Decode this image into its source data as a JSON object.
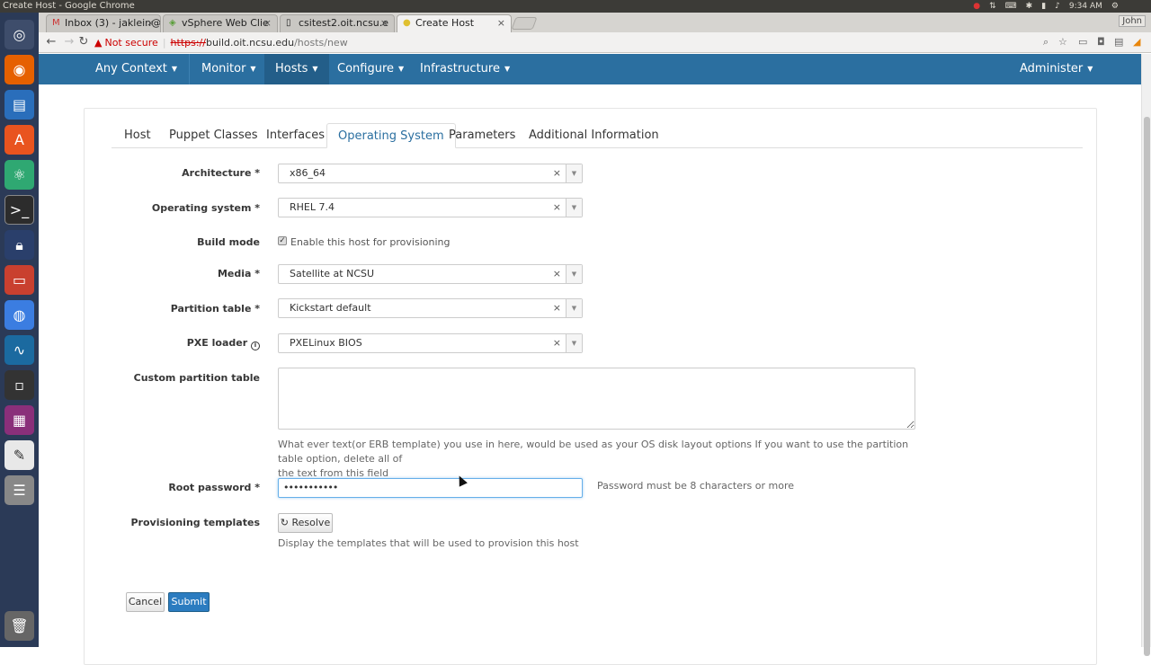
{
  "os": {
    "window_title": "Create Host - Google Chrome",
    "clock": "9:34 AM"
  },
  "launcher": {
    "icons": [
      "ubuntu-logo-icon",
      "firefox-icon",
      "writer-icon",
      "software-center-icon",
      "atom-icon",
      "terminal-icon",
      "lock-icon",
      "files-icon",
      "chrome-icon",
      "wireshark-icon",
      "vm-icon",
      "media-icon",
      "text-editor-icon",
      "disk-icon",
      "trash-icon"
    ]
  },
  "browser": {
    "tabs": [
      {
        "label": "Inbox (3) - jaklein@",
        "icon": "gmail-icon",
        "active": false
      },
      {
        "label": "vSphere Web Clie",
        "icon": "vsphere-icon",
        "active": false
      },
      {
        "label": "csitest2.oit.ncsu.e",
        "icon": "page-icon",
        "active": false
      },
      {
        "label": "Create Host",
        "icon": "page-icon",
        "active": true
      }
    ],
    "user": "John",
    "address": {
      "security": "Not secure",
      "scheme": "https://",
      "host": "build.oit.ncsu.edu",
      "path": "/hosts/new"
    }
  },
  "navbar": {
    "items": [
      {
        "label": "Any Context"
      },
      {
        "label": "Monitor"
      },
      {
        "label": "Hosts"
      },
      {
        "label": "Configure"
      },
      {
        "label": "Infrastructure"
      }
    ],
    "right": {
      "label": "Administer"
    }
  },
  "form_tabs": [
    "Host",
    "Puppet Classes",
    "Interfaces",
    "Operating System",
    "Parameters",
    "Additional Information"
  ],
  "fields": {
    "architecture": {
      "label": "Architecture *",
      "value": "x86_64"
    },
    "operating_system": {
      "label": "Operating system *",
      "value": "RHEL 7.4"
    },
    "build_mode": {
      "label": "Build mode",
      "checkbox_label": "Enable this host for provisioning",
      "checked": true
    },
    "media": {
      "label": "Media *",
      "value": "Satellite at NCSU"
    },
    "partition_table": {
      "label": "Partition table *",
      "value": "Kickstart default"
    },
    "pxe_loader": {
      "label": "PXE loader",
      "value": "PXELinux BIOS"
    },
    "custom_partition_table": {
      "label": "Custom partition table",
      "value": "",
      "help_line1": "What ever text(or ERB template) you use in here, would be used as your OS disk layout options If you want to use the partition table option, delete all of",
      "help_line2": "the text from this field"
    },
    "root_password": {
      "label": "Root password *",
      "value": "•••••••••••",
      "help": "Password must be 8 characters or more"
    },
    "provisioning_templates": {
      "label": "Provisioning templates",
      "button": "Resolve",
      "help": "Display the templates that will be used to provision this host"
    }
  },
  "actions": {
    "cancel": "Cancel",
    "submit": "Submit"
  }
}
